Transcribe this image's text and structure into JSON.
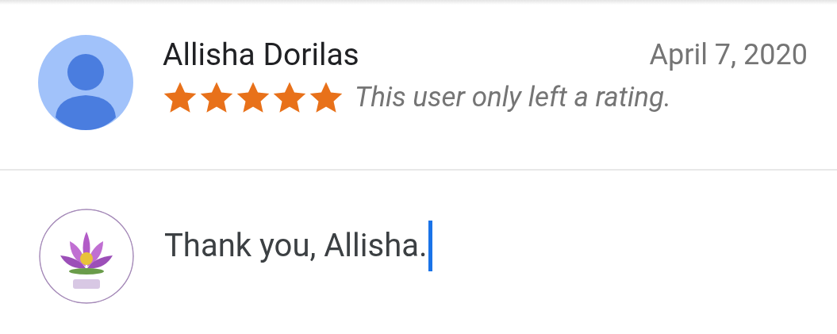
{
  "review": {
    "author": "Allisha Dorilas",
    "date": "April 7, 2020",
    "stars": 5,
    "comment": "This user only left a rating."
  },
  "reply": {
    "value": "Thank you, Allisha.",
    "focused": true
  }
}
